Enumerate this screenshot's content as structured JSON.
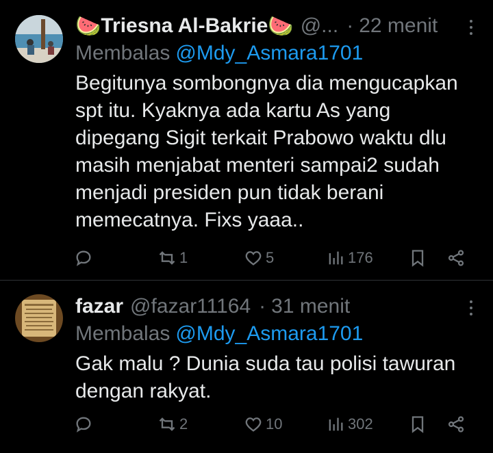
{
  "tweets": [
    {
      "display_name": "Triesna Al-Bakrie",
      "name_emoji": "🍉",
      "handle": "@...",
      "separator": "·",
      "time": "22 menit",
      "replying_label": "Membalas",
      "replying_to": "@Mdy_Asmara1701",
      "text": "Begitunya sombongnya dia mengucapkan\nspt itu. Kyaknya ada kartu As yang\ndipegang Sigit terkait Prabowo waktu dlu\nmasih menjabat menteri sampai2 sudah\nmenjadi presiden pun tidak berani\nmemecatnya. Fixs yaaa..",
      "retweets": "1",
      "likes": "5",
      "views": "176"
    },
    {
      "display_name": "fazar",
      "handle": "@fazar11164",
      "separator": "·",
      "time": "31 menit",
      "replying_label": "Membalas",
      "replying_to": "@Mdy_Asmara1701",
      "text": "Gak malu ? Dunia suda tau polisi tawuran\ndengan rakyat.",
      "retweets": "2",
      "likes": "10",
      "views": "302"
    }
  ],
  "colors": {
    "background": "#000000",
    "text": "#e7e9ea",
    "secondary": "#71767b",
    "link": "#1d9bf0",
    "divider": "#2f3336"
  },
  "icons": [
    "reply-icon",
    "retweet-icon",
    "like-icon",
    "views-icon",
    "bookmark-icon",
    "share-icon",
    "more-icon"
  ]
}
